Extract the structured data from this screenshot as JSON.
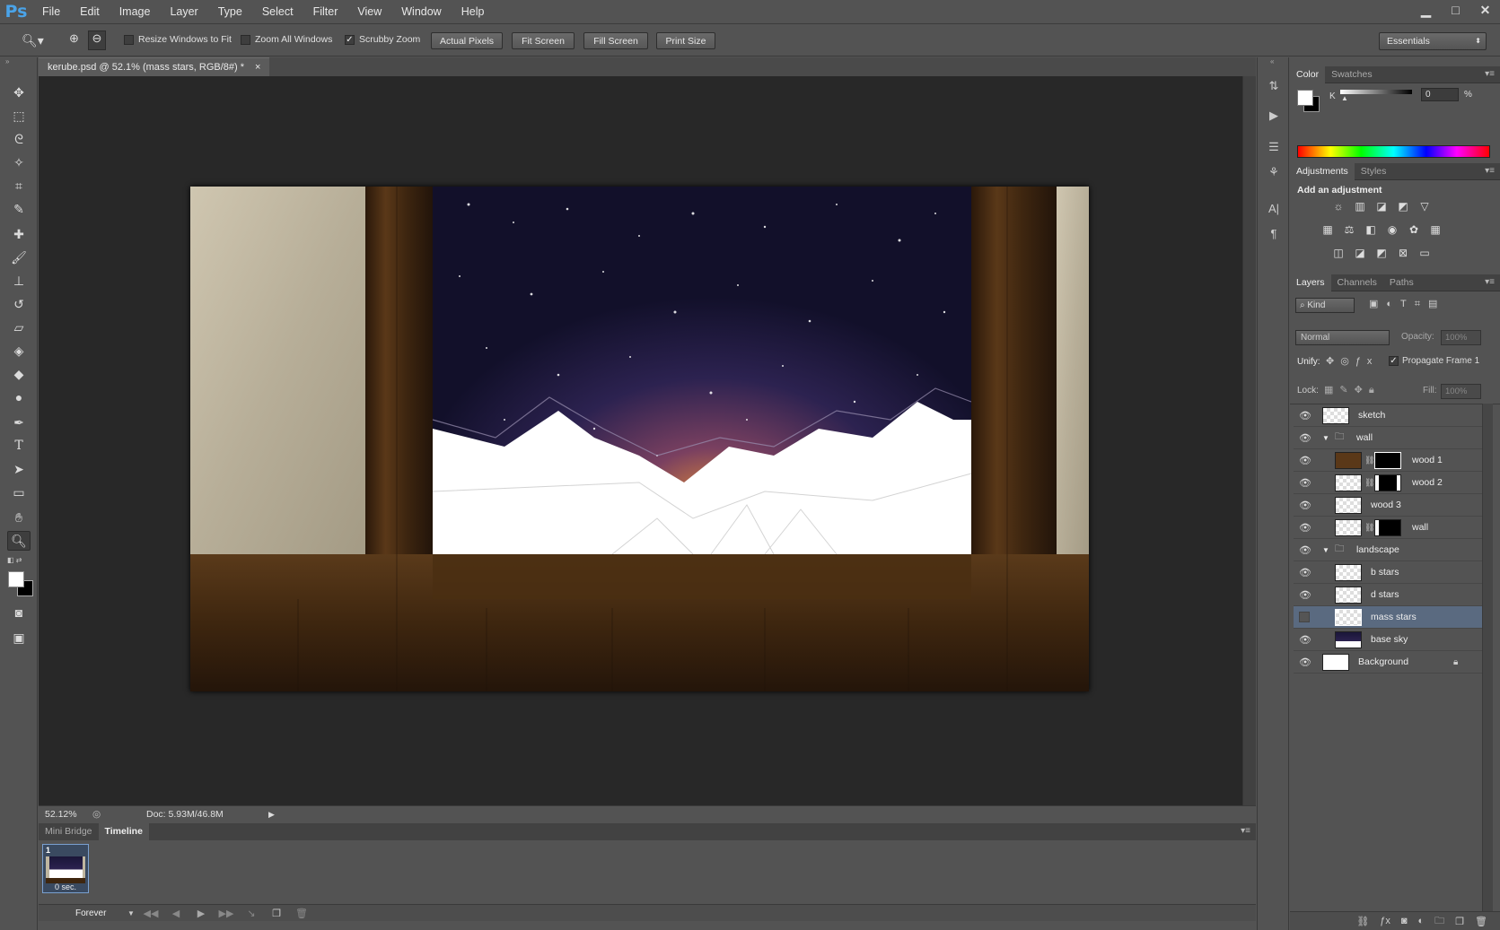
{
  "app": {
    "logo": "Ps"
  },
  "menu": [
    "File",
    "Edit",
    "Image",
    "Layer",
    "Type",
    "Select",
    "Filter",
    "View",
    "Window",
    "Help"
  ],
  "window_controls": {
    "minimize": "▁",
    "maximize": "□",
    "close": "✕"
  },
  "options": {
    "resize_windows": "Resize Windows to Fit",
    "zoom_all": "Zoom All Windows",
    "scrubby": "Scrubby Zoom",
    "actual_pixels": "Actual Pixels",
    "fit_screen": "Fit Screen",
    "fill_screen": "Fill Screen",
    "print_size": "Print Size",
    "workspace": "Essentials",
    "scrubby_checked": true
  },
  "document": {
    "tab_title": "kerube.psd @ 52.1% (mass stars, RGB/8#) *",
    "close": "×",
    "zoom": "52.12%",
    "doc_size": "Doc: 5.93M/46.8M"
  },
  "timeline": {
    "tabs": [
      "Mini Bridge",
      "Timeline"
    ],
    "frame_number": "1",
    "frame_delay": "0 sec.",
    "loop": "Forever"
  },
  "color_panel": {
    "tabs": [
      "Color",
      "Swatches"
    ],
    "channel": "K",
    "value": "0",
    "unit": "%"
  },
  "adjustments_panel": {
    "tabs": [
      "Adjustments",
      "Styles"
    ],
    "heading": "Add an adjustment"
  },
  "layers_panel": {
    "tabs": [
      "Layers",
      "Channels",
      "Paths"
    ],
    "filter": "Kind",
    "blend_mode": "Normal",
    "opacity_label": "Opacity:",
    "opacity": "100%",
    "unify_label": "Unify:",
    "propagate": "Propagate Frame 1",
    "lock_label": "Lock:",
    "fill_label": "Fill:",
    "fill": "100%",
    "layers": [
      {
        "name": "sketch",
        "visible": true,
        "indent": 0
      },
      {
        "name": "wall",
        "visible": true,
        "indent": 0,
        "group": true
      },
      {
        "name": "wood 1",
        "visible": true,
        "indent": 1
      },
      {
        "name": "wood 2",
        "visible": true,
        "indent": 1
      },
      {
        "name": "wood 3",
        "visible": true,
        "indent": 1
      },
      {
        "name": "wall",
        "visible": true,
        "indent": 1
      },
      {
        "name": "landscape",
        "visible": true,
        "indent": 0,
        "group": true
      },
      {
        "name": "b stars",
        "visible": true,
        "indent": 1
      },
      {
        "name": "d stars",
        "visible": true,
        "indent": 1
      },
      {
        "name": "mass stars",
        "visible": false,
        "indent": 1,
        "selected": true
      },
      {
        "name": "base sky",
        "visible": true,
        "indent": 1
      },
      {
        "name": "Background",
        "visible": true,
        "indent": 0
      }
    ]
  }
}
